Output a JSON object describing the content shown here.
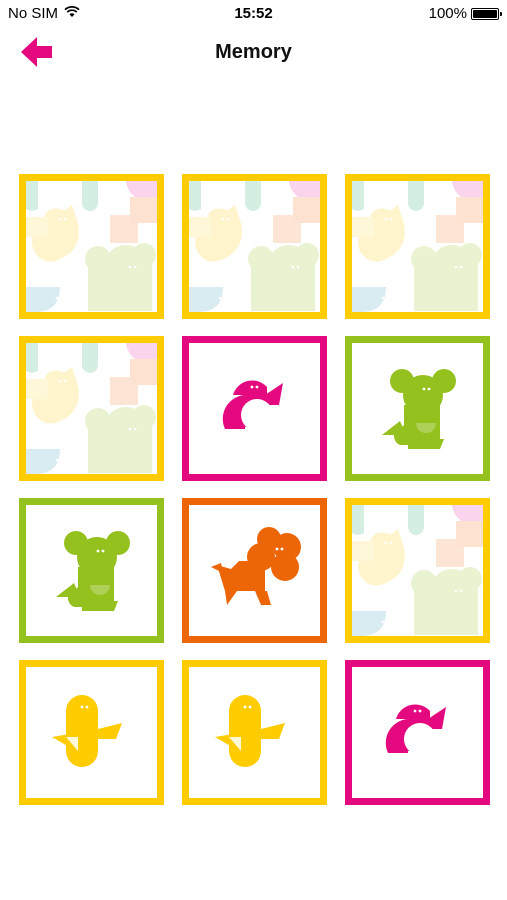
{
  "status_bar": {
    "carrier": "No SIM",
    "time": "15:52",
    "battery": "100%",
    "wifi_icon": "wifi-icon",
    "battery_icon": "battery-icon"
  },
  "nav": {
    "title": "Memory",
    "back_icon": "arrow-left-icon"
  },
  "colors": {
    "yellow": "#ffcc00",
    "pink": "#e5097f",
    "green": "#95c11f",
    "orange": "#ec6608"
  },
  "board": {
    "rows": 4,
    "columns": 3,
    "cards": [
      {
        "state": "face-down",
        "animal": "",
        "color": "#ffcc00"
      },
      {
        "state": "face-down",
        "animal": "",
        "color": "#ffcc00"
      },
      {
        "state": "face-down",
        "animal": "",
        "color": "#ffcc00"
      },
      {
        "state": "face-down",
        "animal": "",
        "color": "#ffcc00"
      },
      {
        "state": "face-up",
        "animal": "penguin",
        "color": "#e5097f"
      },
      {
        "state": "face-up",
        "animal": "koala",
        "color": "#95c11f"
      },
      {
        "state": "face-up",
        "animal": "koala",
        "color": "#95c11f"
      },
      {
        "state": "face-up",
        "animal": "lion",
        "color": "#ec6608"
      },
      {
        "state": "face-down",
        "animal": "",
        "color": "#ffcc00"
      },
      {
        "state": "face-up",
        "animal": "duck",
        "color": "#ffcc00"
      },
      {
        "state": "face-up",
        "animal": "duck",
        "color": "#ffcc00"
      },
      {
        "state": "face-up",
        "animal": "penguin",
        "color": "#e5097f"
      }
    ]
  }
}
